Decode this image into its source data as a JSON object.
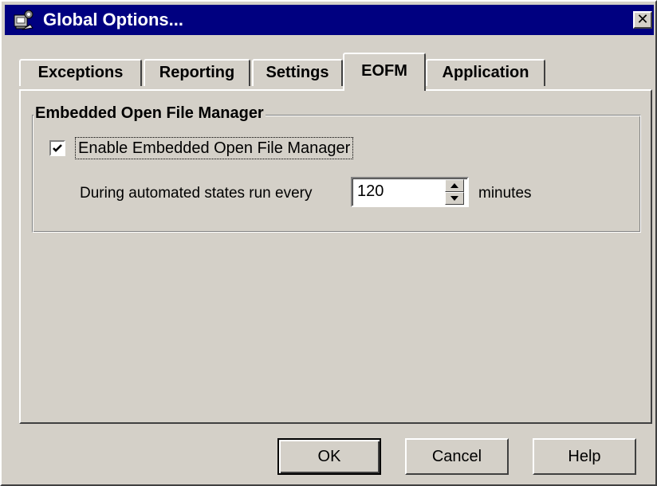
{
  "window": {
    "title": "Global Options...",
    "close_symbol": "✕",
    "title_icon": "computer-settings-icon"
  },
  "tabs": [
    {
      "label": "Exceptions",
      "active": false
    },
    {
      "label": "Reporting",
      "active": false
    },
    {
      "label": "Settings",
      "active": false
    },
    {
      "label": "EOFM",
      "active": true
    },
    {
      "label": "Application",
      "active": false
    }
  ],
  "eofm": {
    "group_label": "Embedded Open File Manager",
    "enable_checkbox": {
      "label": "Enable Embedded Open File Manager",
      "checked": true
    },
    "interval": {
      "prefix_label": "During automated states run every",
      "value": "120",
      "suffix_label": "minutes"
    }
  },
  "buttons": {
    "ok": "OK",
    "cancel": "Cancel",
    "help": "Help"
  },
  "colors": {
    "face": "#d4d0c8",
    "titlebar": "#000080"
  }
}
